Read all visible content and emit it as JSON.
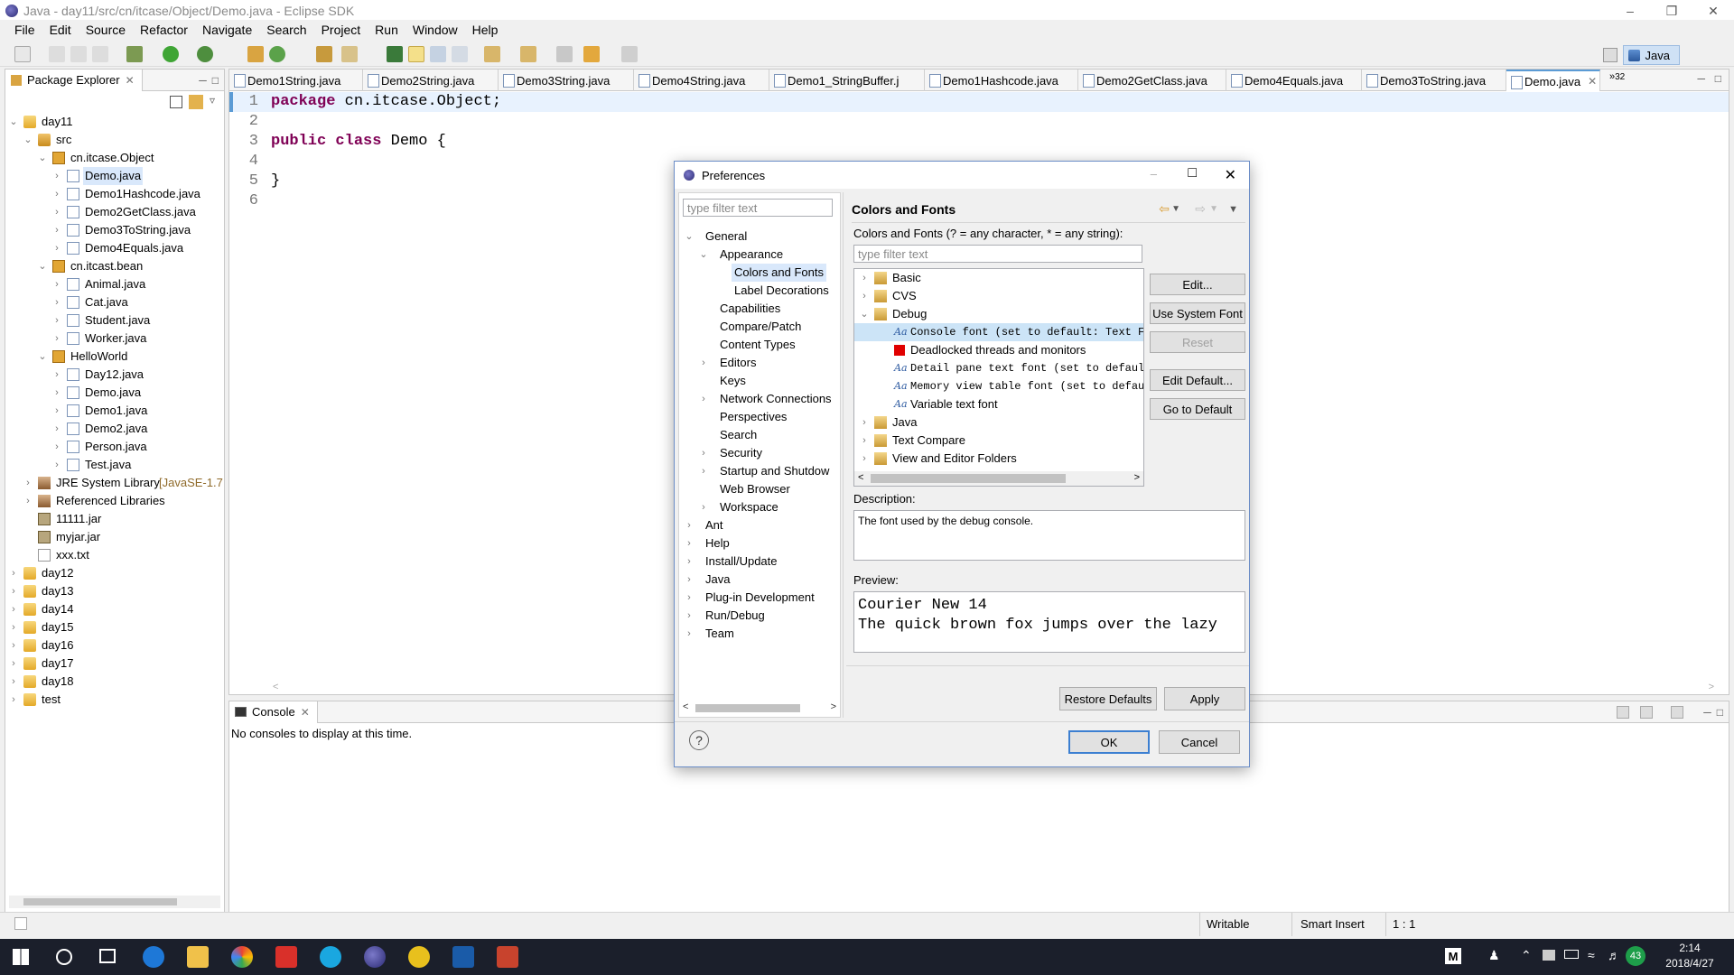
{
  "window": {
    "title": "Java - day11/src/cn/itcase/Object/Demo.java - Eclipse SDK"
  },
  "menu": [
    "File",
    "Edit",
    "Source",
    "Refactor",
    "Navigate",
    "Search",
    "Project",
    "Run",
    "Window",
    "Help"
  ],
  "perspective": {
    "label": "Java"
  },
  "package_explorer": {
    "title": "Package Explorer",
    "rows": [
      {
        "label": "day11",
        "icon": "project-icon",
        "level": 0,
        "arrow": "expanded"
      },
      {
        "label": "src",
        "icon": "source-folder-icon",
        "level": 1,
        "arrow": "expanded"
      },
      {
        "label": "cn.itcase.Object",
        "icon": "package-icon",
        "level": 2,
        "arrow": "expanded"
      },
      {
        "label": "Demo.java",
        "icon": "java-file-icon",
        "level": 3,
        "arrow": "collapsed",
        "selected": true
      },
      {
        "label": "Demo1Hashcode.java",
        "icon": "java-file-icon",
        "level": 3,
        "arrow": "collapsed"
      },
      {
        "label": "Demo2GetClass.java",
        "icon": "java-file-icon",
        "level": 3,
        "arrow": "collapsed"
      },
      {
        "label": "Demo3ToString.java",
        "icon": "java-file-icon",
        "level": 3,
        "arrow": "collapsed"
      },
      {
        "label": "Demo4Equals.java",
        "icon": "java-file-icon",
        "level": 3,
        "arrow": "collapsed"
      },
      {
        "label": "cn.itcast.bean",
        "icon": "package-icon",
        "level": 2,
        "arrow": "expanded"
      },
      {
        "label": "Animal.java",
        "icon": "java-file-icon",
        "level": 3,
        "arrow": "collapsed"
      },
      {
        "label": "Cat.java",
        "icon": "java-file-icon",
        "level": 3,
        "arrow": "collapsed"
      },
      {
        "label": "Student.java",
        "icon": "java-file-icon",
        "level": 3,
        "arrow": "collapsed"
      },
      {
        "label": "Worker.java",
        "icon": "java-file-icon",
        "level": 3,
        "arrow": "collapsed"
      },
      {
        "label": "HelloWorld",
        "icon": "package-icon",
        "level": 2,
        "arrow": "expanded"
      },
      {
        "label": "Day12.java",
        "icon": "java-file-icon",
        "level": 3,
        "arrow": "collapsed"
      },
      {
        "label": "Demo.java",
        "icon": "java-file-icon",
        "level": 3,
        "arrow": "collapsed"
      },
      {
        "label": "Demo1.java",
        "icon": "java-file-icon",
        "level": 3,
        "arrow": "collapsed"
      },
      {
        "label": "Demo2.java",
        "icon": "java-file-icon",
        "level": 3,
        "arrow": "collapsed"
      },
      {
        "label": "Person.java",
        "icon": "java-file-icon",
        "level": 3,
        "arrow": "collapsed"
      },
      {
        "label": "Test.java",
        "icon": "java-file-icon",
        "level": 3,
        "arrow": "collapsed"
      },
      {
        "label": "JRE System Library",
        "suffix": "[JavaSE-1.7",
        "icon": "library-icon",
        "level": 1,
        "arrow": "collapsed"
      },
      {
        "label": "Referenced Libraries",
        "icon": "library-icon",
        "level": 1,
        "arrow": "collapsed"
      },
      {
        "label": "11111.jar",
        "icon": "jar-icon",
        "level": 1,
        "arrow": "none"
      },
      {
        "label": "myjar.jar",
        "icon": "jar-icon",
        "level": 1,
        "arrow": "none"
      },
      {
        "label": "xxx.txt",
        "icon": "text-file-icon",
        "level": 1,
        "arrow": "none"
      },
      {
        "label": "day12",
        "icon": "project-icon",
        "level": 0,
        "arrow": "collapsed"
      },
      {
        "label": "day13",
        "icon": "project-icon",
        "level": 0,
        "arrow": "collapsed"
      },
      {
        "label": "day14",
        "icon": "project-icon",
        "level": 0,
        "arrow": "collapsed"
      },
      {
        "label": "day15",
        "icon": "project-icon",
        "level": 0,
        "arrow": "collapsed"
      },
      {
        "label": "day16",
        "icon": "project-icon",
        "level": 0,
        "arrow": "collapsed"
      },
      {
        "label": "day17",
        "icon": "project-icon",
        "level": 0,
        "arrow": "collapsed"
      },
      {
        "label": "day18",
        "icon": "project-icon",
        "level": 0,
        "arrow": "collapsed"
      },
      {
        "label": "test",
        "icon": "project-icon",
        "level": 0,
        "arrow": "collapsed"
      }
    ]
  },
  "editor": {
    "tabs": [
      "Demo1String.java",
      "Demo2String.java",
      "Demo3String.java",
      "Demo4String.java",
      "Demo1_StringBuffer.j",
      "Demo1Hashcode.java",
      "Demo2GetClass.java",
      "Demo4Equals.java",
      "Demo3ToString.java",
      "Demo.java"
    ],
    "overflow_count": "32",
    "line_numbers": [
      "1",
      "2",
      "3",
      "4",
      "5",
      "6"
    ],
    "lines": [
      {
        "kw": "package",
        "rest": " cn.itcase.Object;"
      },
      {
        "kw": "",
        "rest": ""
      },
      {
        "kw": "public class",
        "rest": " Demo {"
      },
      {
        "kw": "",
        "rest": ""
      },
      {
        "kw": "",
        "rest": "}"
      },
      {
        "kw": "",
        "rest": ""
      }
    ]
  },
  "console": {
    "title": "Console",
    "message": "No consoles to display at this time."
  },
  "status": {
    "writable": "Writable",
    "insert_mode": "Smart Insert",
    "position": "1 : 1"
  },
  "preferences": {
    "title": "Preferences",
    "filter_placeholder": "type filter text",
    "nav": [
      {
        "label": "General",
        "level": 0,
        "arrow": "expanded"
      },
      {
        "label": "Appearance",
        "level": 1,
        "arrow": "expanded"
      },
      {
        "label": "Colors and Fonts",
        "level": 2,
        "arrow": "none",
        "selected": true
      },
      {
        "label": "Label Decorations",
        "level": 2,
        "arrow": "none"
      },
      {
        "label": "Capabilities",
        "level": 1,
        "arrow": "none"
      },
      {
        "label": "Compare/Patch",
        "level": 1,
        "arrow": "none"
      },
      {
        "label": "Content Types",
        "level": 1,
        "arrow": "none"
      },
      {
        "label": "Editors",
        "level": 1,
        "arrow": "collapsed"
      },
      {
        "label": "Keys",
        "level": 1,
        "arrow": "none"
      },
      {
        "label": "Network Connections",
        "level": 1,
        "arrow": "collapsed"
      },
      {
        "label": "Perspectives",
        "level": 1,
        "arrow": "none"
      },
      {
        "label": "Search",
        "level": 1,
        "arrow": "none"
      },
      {
        "label": "Security",
        "level": 1,
        "arrow": "collapsed"
      },
      {
        "label": "Startup and Shutdow",
        "level": 1,
        "arrow": "collapsed"
      },
      {
        "label": "Web Browser",
        "level": 1,
        "arrow": "none"
      },
      {
        "label": "Workspace",
        "level": 1,
        "arrow": "collapsed"
      },
      {
        "label": "Ant",
        "level": 0,
        "arrow": "collapsed"
      },
      {
        "label": "Help",
        "level": 0,
        "arrow": "collapsed"
      },
      {
        "label": "Install/Update",
        "level": 0,
        "arrow": "collapsed"
      },
      {
        "label": "Java",
        "level": 0,
        "arrow": "collapsed"
      },
      {
        "label": "Plug-in Development",
        "level": 0,
        "arrow": "collapsed"
      },
      {
        "label": "Run/Debug",
        "level": 0,
        "arrow": "collapsed"
      },
      {
        "label": "Team",
        "level": 0,
        "arrow": "collapsed"
      }
    ],
    "page_title": "Colors and Fonts",
    "hint": "Colors and Fonts (? = any character, * = any string):",
    "tree_filter_placeholder": "type filter text",
    "tree": [
      {
        "label": "Basic",
        "kind": "folder",
        "level": 0,
        "arrow": "collapsed"
      },
      {
        "label": "CVS",
        "kind": "folder",
        "level": 0,
        "arrow": "collapsed"
      },
      {
        "label": "Debug",
        "kind": "folder",
        "level": 0,
        "arrow": "expanded"
      },
      {
        "label": "Console font (set to default: Text Fo",
        "kind": "font",
        "level": 1,
        "arrow": "none",
        "selected": true
      },
      {
        "label": "Deadlocked threads and monitors",
        "kind": "color",
        "color": "#e00000",
        "level": 1,
        "arrow": "none"
      },
      {
        "label": "Detail pane text font (set to default",
        "kind": "font",
        "level": 1,
        "arrow": "none"
      },
      {
        "label": "Memory view table font (set to defaul",
        "kind": "font",
        "level": 1,
        "arrow": "none"
      },
      {
        "label": "Variable text font",
        "kind": "font-plain",
        "level": 1,
        "arrow": "none"
      },
      {
        "label": "Java",
        "kind": "folder",
        "level": 0,
        "arrow": "collapsed"
      },
      {
        "label": "Text Compare",
        "kind": "folder",
        "level": 0,
        "arrow": "collapsed"
      },
      {
        "label": "View and Editor Folders",
        "kind": "folder",
        "level": 0,
        "arrow": "collapsed"
      }
    ],
    "font_glyph": "Aa",
    "buttons": {
      "edit": "Edit...",
      "use_system_font": "Use System Font",
      "reset": "Reset",
      "edit_default": "Edit Default...",
      "go_to_default": "Go to Default"
    },
    "description_label": "Description:",
    "description": "The font used by the debug console.",
    "preview_label": "Preview:",
    "preview_line1": "Courier New 14",
    "preview_line2": "The quick brown fox jumps over the lazy",
    "restore_defaults": "Restore Defaults",
    "apply": "Apply",
    "ok": "OK",
    "cancel": "Cancel",
    "help_glyph": "?"
  },
  "taskbar": {
    "time": "2:14",
    "date": "2018/4/27",
    "tray_badge": "43",
    "tray_ime": "M"
  }
}
